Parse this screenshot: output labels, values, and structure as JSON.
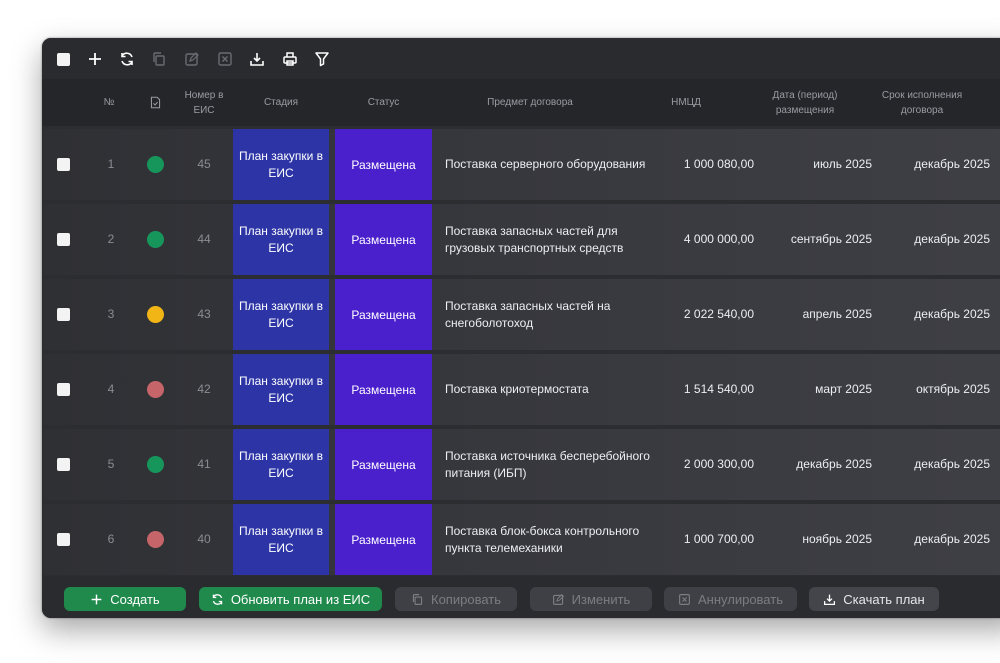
{
  "header": {
    "num": "№",
    "eis": "Номер в ЕИС",
    "stage": "Стадия",
    "status": "Статус",
    "subject": "Предмет договора",
    "price": "НМЦД",
    "placement_date": "Дата (период) размещения",
    "deadline": "Срок исполнения договора"
  },
  "rows": [
    {
      "num": "1",
      "eis": "45",
      "stage": "План закупки в ЕИС",
      "status": "Размещена",
      "subject": "Поставка серверного оборудования",
      "price": "1 000 080,00",
      "placement_date": "июль 2025",
      "deadline": "декабрь 2025",
      "dot": "#17965c"
    },
    {
      "num": "2",
      "eis": "44",
      "stage": "План закупки в ЕИС",
      "status": "Размещена",
      "subject": "Поставка запасных частей для грузовых транспортных средств",
      "price": "4 000 000,00",
      "placement_date": "сентябрь 2025",
      "deadline": "декабрь 2025",
      "dot": "#17965c"
    },
    {
      "num": "3",
      "eis": "43",
      "stage": "План закупки в ЕИС",
      "status": "Размещена",
      "subject": "Поставка запасных частей на снегоболотоход",
      "price": "2 022 540,00",
      "placement_date": "апрель 2025",
      "deadline": "декабрь 2025",
      "dot": "#f2b516"
    },
    {
      "num": "4",
      "eis": "42",
      "stage": "План закупки в ЕИС",
      "status": "Размещена",
      "subject": "Поставка криотермостата",
      "price": "1 514 540,00",
      "placement_date": "март 2025",
      "deadline": "октябрь 2025",
      "dot": "#c56569"
    },
    {
      "num": "5",
      "eis": "41",
      "stage": "План закупки в ЕИС",
      "status": "Размещена",
      "subject": "Поставка источника бесперебойного питания (ИБП)",
      "price": "2 000 300,00",
      "placement_date": "декабрь 2025",
      "deadline": "декабрь 2025",
      "dot": "#17965c"
    },
    {
      "num": "6",
      "eis": "40",
      "stage": "План закупки в ЕИС",
      "status": "Размещена",
      "subject": "Поставка блок-бокса контрольного пункта телемеханики",
      "price": "1 000 700,00",
      "placement_date": "ноябрь 2025",
      "deadline": "декабрь 2025",
      "dot": "#c56569"
    }
  ],
  "footer": {
    "create": "Создать",
    "refresh": "Обновить план из ЕИС",
    "copy": "Копировать",
    "edit": "Изменить",
    "cancel": "Аннулировать",
    "download": "Скачать план"
  },
  "colors": {
    "green": "#1f8a4c",
    "stage": "#2d35a6",
    "status": "#4a1fcc"
  },
  "icons": [
    "checkbox-icon",
    "plus-icon",
    "refresh-icon",
    "copy-icon",
    "edit-icon",
    "cancel-icon",
    "download-icon",
    "print-icon",
    "filter-icon",
    "document-check-icon"
  ]
}
